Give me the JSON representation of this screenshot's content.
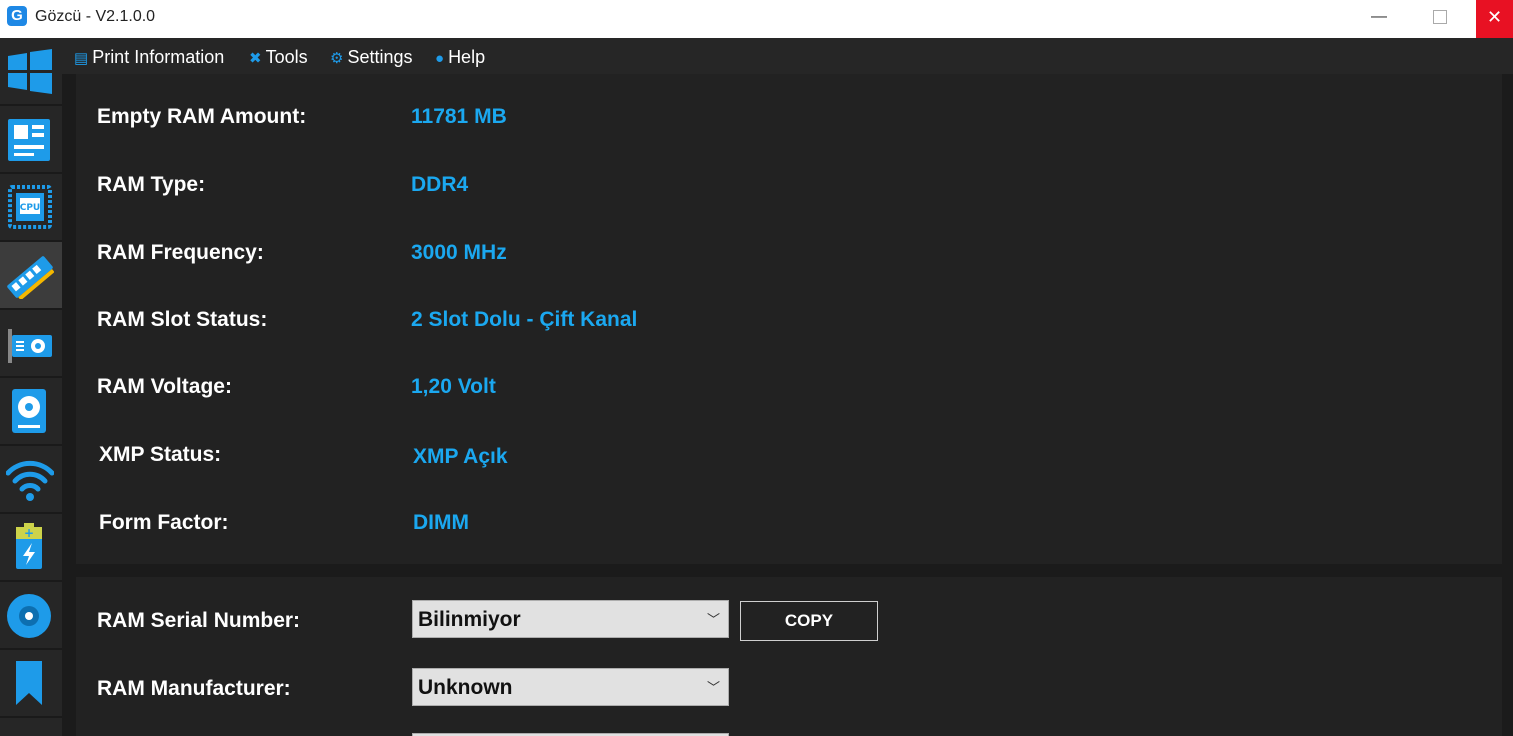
{
  "window": {
    "title": "Gözcü - V2.1.0.0",
    "app_icon_letter": "G",
    "minimize": "—",
    "close": "✕"
  },
  "menu": [
    {
      "label": "Print Information",
      "icon": "print-icon"
    },
    {
      "label": "Tools",
      "icon": "tools-icon"
    },
    {
      "label": "Settings",
      "icon": "gear-icon"
    },
    {
      "label": "Help",
      "icon": "help-icon"
    }
  ],
  "sidebar": {
    "items": [
      "windows",
      "motherboard",
      "cpu",
      "ram",
      "gpu",
      "storage",
      "network",
      "battery",
      "disc",
      "bookmark"
    ],
    "active": "ram"
  },
  "ram_info": {
    "rows": [
      {
        "label": "Empty RAM Amount:",
        "value": "11781 MB"
      },
      {
        "label": "RAM Type:",
        "value": "DDR4"
      },
      {
        "label": "RAM Frequency:",
        "value": "3000 MHz"
      },
      {
        "label": "RAM Slot Status:",
        "value": "2 Slot Dolu - Çift Kanal"
      },
      {
        "label": "RAM Voltage:",
        "value": "1,20 Volt"
      },
      {
        "label": "XMP Status:",
        "value": "XMP Açık"
      },
      {
        "label": "Form Factor:",
        "value": "DIMM"
      }
    ]
  },
  "ram_details": {
    "serial_label": "RAM Serial Number:",
    "serial_value": "Bilinmiyor",
    "copy_label": "COPY",
    "manufacturer_label": "RAM Manufacturer:",
    "manufacturer_value": "Unknown"
  },
  "colors": {
    "accent": "#1ba8f0",
    "background": "#1b1b1b",
    "panel": "#222222",
    "sidebar": "#262626",
    "close": "#e81123"
  }
}
